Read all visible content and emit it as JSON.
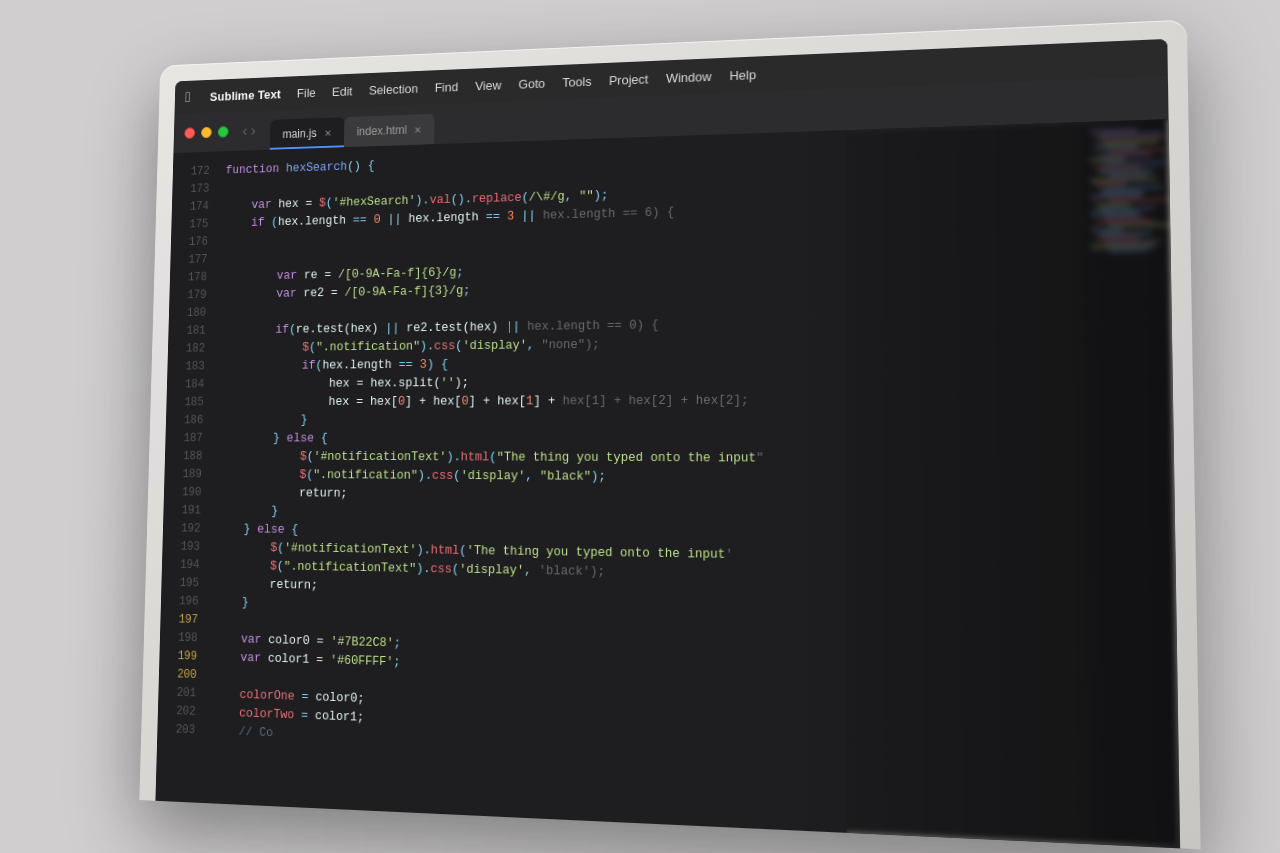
{
  "app": {
    "title": "Sublime Text"
  },
  "menubar": {
    "apple": "&#63743;",
    "items": [
      {
        "label": "Sublime Text"
      },
      {
        "label": "File"
      },
      {
        "label": "Edit"
      },
      {
        "label": "Selection"
      },
      {
        "label": "Find"
      },
      {
        "label": "View"
      },
      {
        "label": "Goto"
      },
      {
        "label": "Tools"
      },
      {
        "label": "Project"
      },
      {
        "label": "Window"
      },
      {
        "label": "Help"
      }
    ]
  },
  "tabs": [
    {
      "label": "main.js",
      "active": true
    },
    {
      "label": "index.html",
      "active": false
    }
  ],
  "code": {
    "lines": [
      {
        "num": "172",
        "highlight": false
      },
      {
        "num": "173",
        "highlight": false
      },
      {
        "num": "174",
        "highlight": false
      },
      {
        "num": "175",
        "highlight": false
      },
      {
        "num": "176",
        "highlight": false
      },
      {
        "num": "177",
        "highlight": false
      },
      {
        "num": "178",
        "highlight": false
      },
      {
        "num": "179",
        "highlight": false
      },
      {
        "num": "180",
        "highlight": false
      },
      {
        "num": "181",
        "highlight": false
      },
      {
        "num": "182",
        "highlight": false
      },
      {
        "num": "183",
        "highlight": false
      },
      {
        "num": "184",
        "highlight": false
      },
      {
        "num": "185",
        "highlight": false
      },
      {
        "num": "186",
        "highlight": false
      },
      {
        "num": "187",
        "highlight": false
      },
      {
        "num": "188",
        "highlight": false
      },
      {
        "num": "189",
        "highlight": false
      },
      {
        "num": "190",
        "highlight": false
      },
      {
        "num": "191",
        "highlight": false
      },
      {
        "num": "192",
        "highlight": false
      },
      {
        "num": "193",
        "highlight": false
      },
      {
        "num": "194",
        "highlight": false
      },
      {
        "num": "195",
        "highlight": false
      },
      {
        "num": "196",
        "highlight": false
      },
      {
        "num": "197",
        "highlight": true
      },
      {
        "num": "198",
        "highlight": false
      },
      {
        "num": "199",
        "highlight": true
      },
      {
        "num": "200",
        "highlight": true
      },
      {
        "num": "201",
        "highlight": false
      },
      {
        "num": "202",
        "highlight": false
      },
      {
        "num": "203",
        "highlight": false
      }
    ]
  }
}
